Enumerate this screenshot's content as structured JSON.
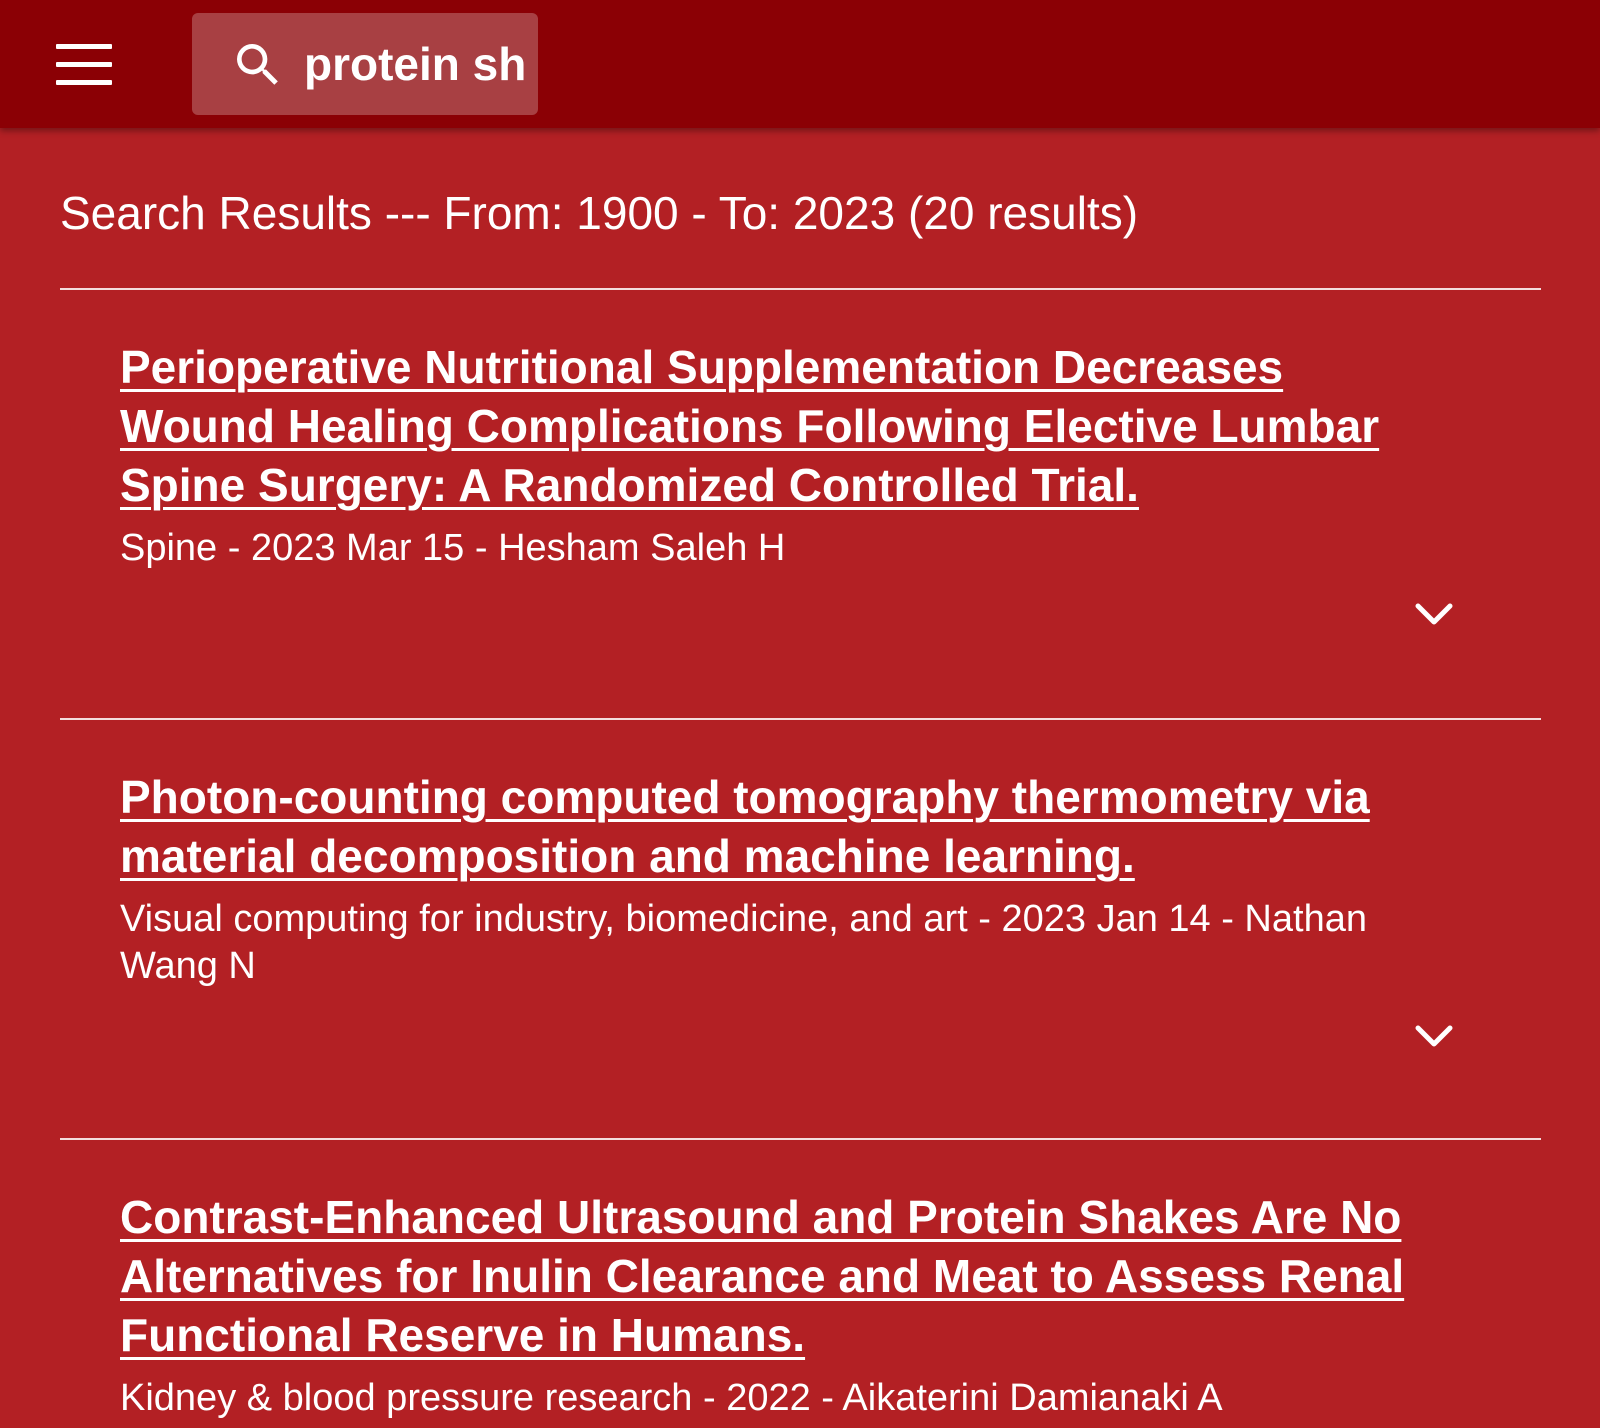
{
  "toolbar": {
    "menu_icon": "hamburger-menu-icon",
    "search_icon": "search-icon",
    "search_value": "protein sh"
  },
  "results": {
    "header": "Search Results --- From: 1900 - To: 2023 (20 results)",
    "items": [
      {
        "title": "Perioperative Nutritional Supplementation Decreases Wound Healing Complications Following Elective Lumbar Spine Surgery: A Randomized Controlled Trial.",
        "meta": "Spine - 2023 Mar 15 - Hesham Saleh H",
        "expand_icon": "chevron-down-icon"
      },
      {
        "title": "Photon-counting computed tomography thermometry via material decomposition and machine learning.",
        "meta": "Visual computing for industry, biomedicine, and art - 2023 Jan 14 - Nathan Wang N",
        "expand_icon": "chevron-down-icon"
      },
      {
        "title": "Contrast-Enhanced Ultrasound and Protein Shakes Are No Alternatives for Inulin Clearance and Meat to Assess Renal Functional Reserve in Humans.",
        "meta": "Kidney & blood pressure research - 2022 - Aikaterini Damianaki A"
      }
    ]
  },
  "colors": {
    "toolbar_bg": "#8b0005",
    "page_bg": "#b32024",
    "text": "#ffffff"
  }
}
